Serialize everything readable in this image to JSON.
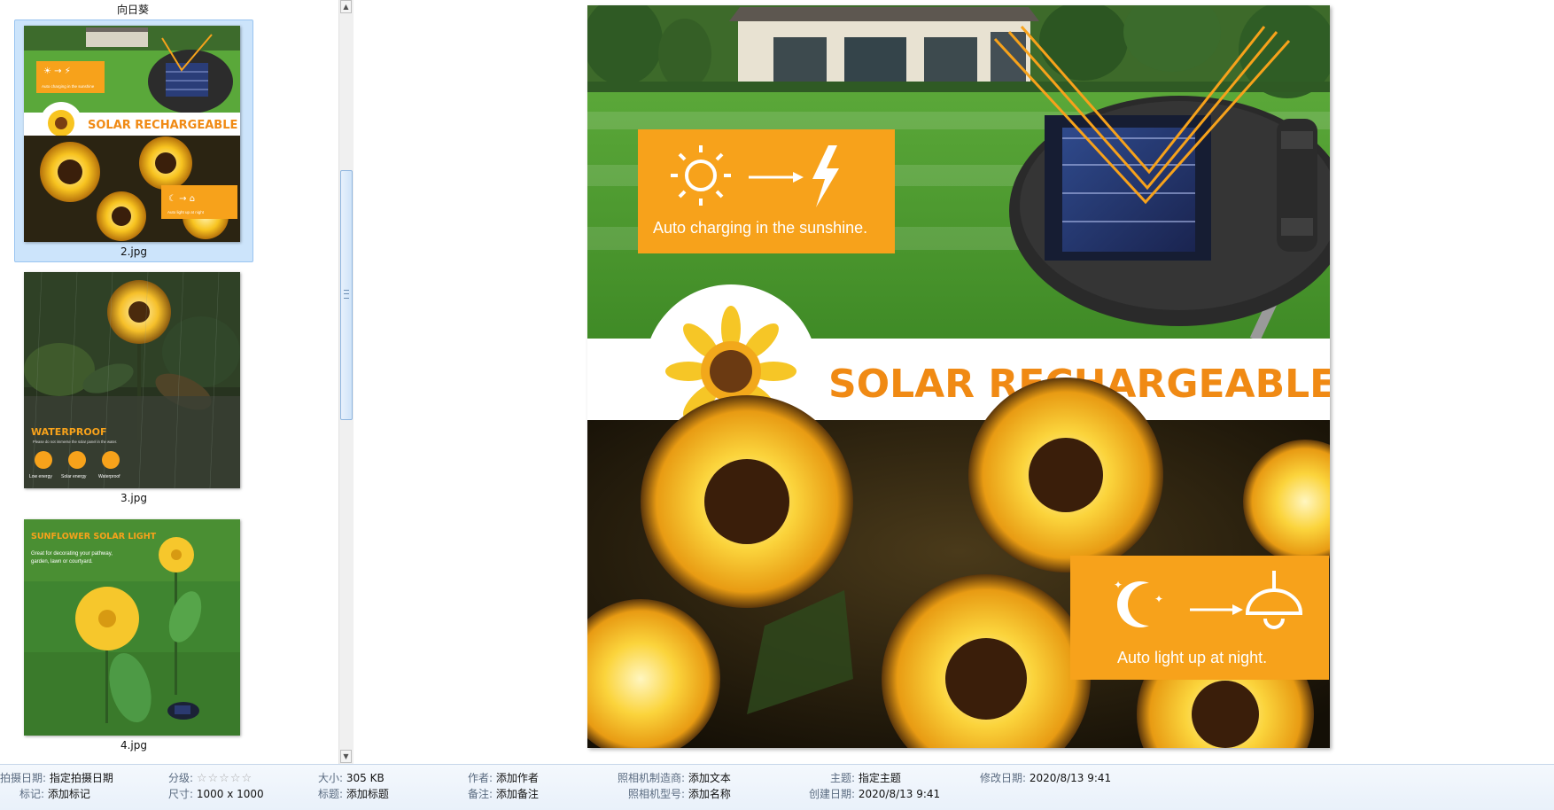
{
  "folder": {
    "name": "向日葵"
  },
  "thumbnails": [
    {
      "filename": "2.jpg",
      "selected": true
    },
    {
      "filename": "3.jpg",
      "selected": false
    },
    {
      "filename": "4.jpg",
      "selected": false
    }
  ],
  "thumb2": {
    "badge1": "Auto charging in the sunshine",
    "banner": "SOLAR RECHARGEABLE",
    "badge2": "Auto light up at night"
  },
  "thumb3": {
    "title": "WATERPROOF",
    "subtitle": "Please do not immerse the solar panel in the water.",
    "features": [
      "Low energy",
      "Solar energy",
      "Waterproof"
    ]
  },
  "thumb4": {
    "title": "SUNFLOWER SOLAR LIGHT",
    "subtitle_line1": "Great for decorating your pathway,",
    "subtitle_line2": "garden, lawn or courtyard."
  },
  "preview": {
    "badge_top": "Auto charging in the sunshine.",
    "banner_text": "SOLAR RECHARGEABLE",
    "badge_bottom": "Auto light up at night."
  },
  "details": {
    "date_taken_label": "拍摄日期:",
    "date_taken_value": "指定拍摄日期",
    "tags_label": "标记:",
    "tags_value": "添加标记",
    "rating_label": "分级:",
    "rating_value": 0,
    "dimensions_label": "尺寸:",
    "dimensions_value": "1000 x 1000",
    "size_label": "大小:",
    "size_value": "305 KB",
    "title_label": "标题:",
    "title_value": "添加标题",
    "author_label": "作者:",
    "author_value": "添加作者",
    "comments_label": "备注:",
    "comments_value": "添加备注",
    "camera_maker_label": "照相机制造商:",
    "camera_maker_value": "添加文本",
    "camera_model_label": "照相机型号:",
    "camera_model_value": "添加名称",
    "subject_label": "主题:",
    "subject_value": "指定主题",
    "created_label": "创建日期:",
    "created_value": "2020/8/13 9:41",
    "modified_label": "修改日期:",
    "modified_value": "2020/8/13 9:41"
  },
  "colors": {
    "accent_orange": "#f7a21b",
    "banner_text_orange": "#f08a14",
    "selection_blue": "#cce4fb",
    "grass_green": "#4f9a32"
  }
}
